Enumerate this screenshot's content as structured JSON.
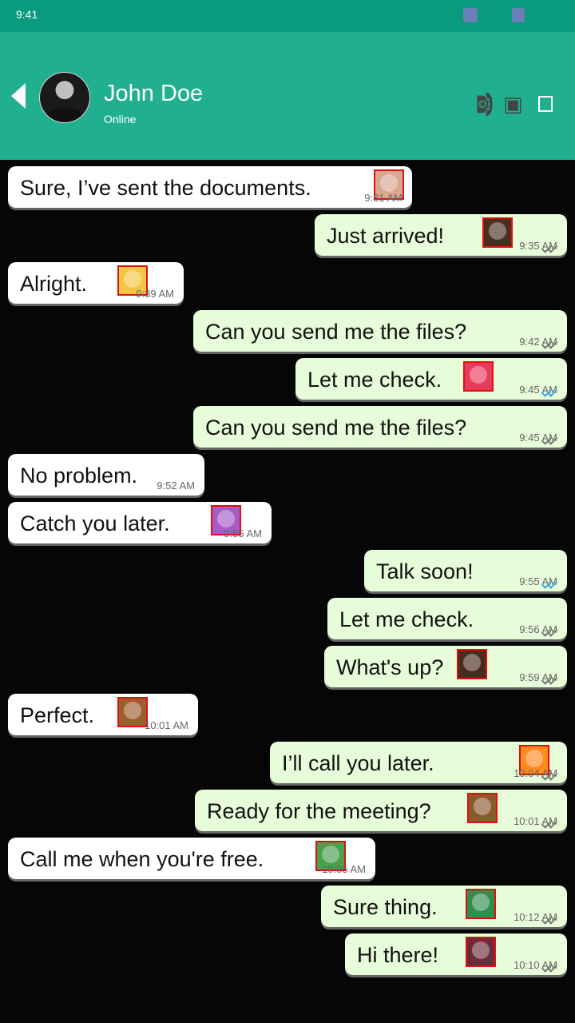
{
  "status_bar": {
    "time": "9:41"
  },
  "header": {
    "name": "John Doe",
    "status": "Online"
  },
  "messages": [
    {
      "text": "Sure, I’ve sent the documents.",
      "time": "9:31 AM",
      "direction": "incoming",
      "emoji": "bride-emoji"
    },
    {
      "text": "Just arrived!",
      "time": "9:35 AM",
      "direction": "outgoing",
      "emoji": "fist-emoji",
      "ticks": "grey"
    },
    {
      "text": "Alright.",
      "time": "9:39 AM",
      "direction": "incoming",
      "emoji": "police-officer-emoji"
    },
    {
      "text": "Can you send me the files?",
      "time": "9:42 AM",
      "direction": "outgoing",
      "emoji": "",
      "ticks": "grey"
    },
    {
      "text": "Let me check.",
      "time": "9:45 AM",
      "direction": "outgoing",
      "emoji": "b-button-emoji",
      "ticks": "blue"
    },
    {
      "text": "Can you send me the files?",
      "time": "9:45 AM",
      "direction": "outgoing",
      "emoji": "",
      "ticks": "grey"
    },
    {
      "text": "No problem.",
      "time": "9:52 AM",
      "direction": "incoming",
      "emoji": ""
    },
    {
      "text": "Catch you later.",
      "time": "9:55 AM",
      "direction": "incoming",
      "emoji": "weightlifter-emoji"
    },
    {
      "text": "Talk soon!",
      "time": "9:55 AM",
      "direction": "outgoing",
      "emoji": "",
      "ticks": "blue"
    },
    {
      "text": "Let me check.",
      "time": "9:56 AM",
      "direction": "outgoing",
      "emoji": "",
      "ticks": "grey"
    },
    {
      "text": "What's up?",
      "time": "9:59 AM",
      "direction": "outgoing",
      "emoji": "pointing-up-emoji",
      "ticks": "grey"
    },
    {
      "text": "Perfect.",
      "time": "10:01 AM",
      "direction": "incoming",
      "emoji": "cyclist-emoji"
    },
    {
      "text": "I’ll call you later.",
      "time": "10:04 AM",
      "direction": "outgoing",
      "emoji": "tangerine-emoji",
      "ticks": "grey"
    },
    {
      "text": "Ready for the meeting?",
      "time": "10:01 AM",
      "direction": "outgoing",
      "emoji": "person-emoji",
      "ticks": "grey"
    },
    {
      "text": "Call me when you're free.",
      "time": "10:05 AM",
      "direction": "incoming",
      "emoji": "truck-emoji"
    },
    {
      "text": "Sure thing.",
      "time": "10:12 AM",
      "direction": "outgoing",
      "emoji": "comoros-flag-emoji",
      "ticks": "grey"
    },
    {
      "text": "Hi there!",
      "time": "10:10 AM",
      "direction": "outgoing",
      "emoji": "superhero-emoji",
      "ticks": "grey"
    }
  ]
}
